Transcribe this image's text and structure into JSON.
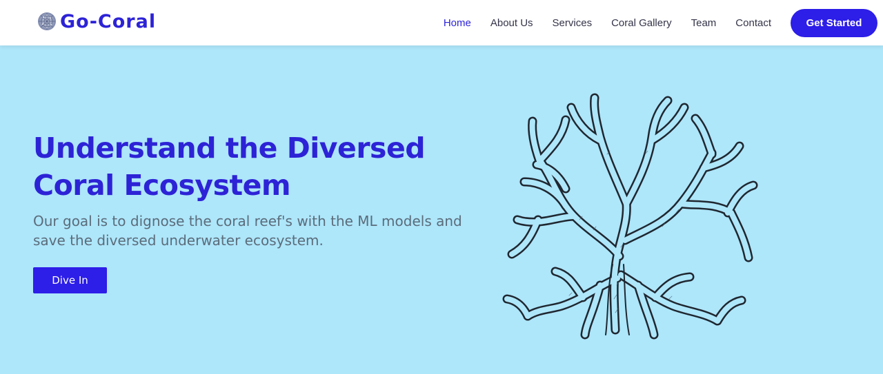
{
  "brand": {
    "name": "Go-Coral",
    "icon": "coral-logo-icon"
  },
  "nav": {
    "items": [
      {
        "label": "Home",
        "active": true
      },
      {
        "label": "About Us",
        "active": false
      },
      {
        "label": "Services",
        "active": false
      },
      {
        "label": "Coral Gallery",
        "active": false
      },
      {
        "label": "Team",
        "active": false
      },
      {
        "label": "Contact",
        "active": false
      }
    ],
    "cta_label": "Get Started"
  },
  "hero": {
    "title_line1": "Understand the Diversed",
    "title_line2": "Coral Ecosystem",
    "subtitle": "Our goal is to dignose the coral reef's with the ML models and save the diversed underwater ecosystem.",
    "button_label": "Dive In",
    "illustration": "coral-illustration"
  },
  "colors": {
    "accent": "#2d23d6",
    "button": "#2d1ee8",
    "hero_bg": "#aee6fa",
    "header_bg": "#ffffff",
    "subtitle_text": "#5b6c7a"
  }
}
